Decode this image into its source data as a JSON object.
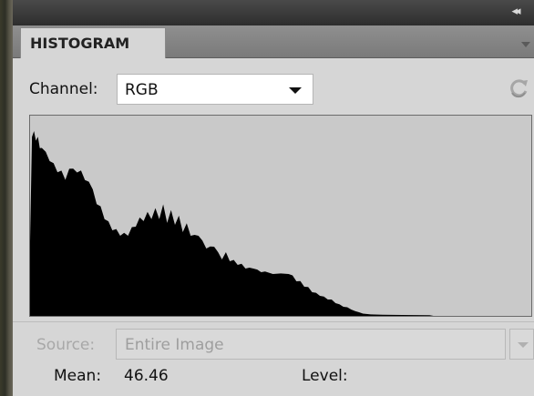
{
  "panel": {
    "tab_title": "HISTOGRAM",
    "collapse_glyph": "◂◂"
  },
  "channel": {
    "label": "Channel:",
    "value": "RGB"
  },
  "source": {
    "label": "Source:",
    "value": "Entire Image"
  },
  "stats": {
    "mean_label": "Mean:",
    "mean_value": "46.46",
    "level_label": "Level:"
  },
  "colors": {
    "panel_bg": "#d6d6d6",
    "histogram_bg": "#c9c9c9",
    "histogram_fill": "#000000"
  },
  "icons": [
    "collapse-panel-icon",
    "panel-menu-icon",
    "dropdown-arrow-icon",
    "refresh-icon"
  ],
  "histogram": {
    "bins": 256,
    "relative_counts": [
      [
        0,
        0.41
      ],
      [
        1,
        0.94
      ],
      [
        2,
        1.0
      ],
      [
        3,
        0.92
      ],
      [
        4,
        0.97
      ],
      [
        5,
        0.88
      ],
      [
        6,
        0.91
      ],
      [
        8,
        0.86
      ],
      [
        10,
        0.84
      ],
      [
        12,
        0.8
      ],
      [
        14,
        0.78
      ],
      [
        16,
        0.76
      ],
      [
        18,
        0.74
      ],
      [
        20,
        0.77
      ],
      [
        22,
        0.8
      ],
      [
        24,
        0.75
      ],
      [
        26,
        0.79
      ],
      [
        28,
        0.71
      ],
      [
        30,
        0.73
      ],
      [
        32,
        0.66
      ],
      [
        34,
        0.61
      ],
      [
        36,
        0.57
      ],
      [
        38,
        0.53
      ],
      [
        40,
        0.49
      ],
      [
        42,
        0.47
      ],
      [
        44,
        0.45
      ],
      [
        46,
        0.44
      ],
      [
        48,
        0.43
      ],
      [
        50,
        0.44
      ],
      [
        52,
        0.46
      ],
      [
        54,
        0.49
      ],
      [
        56,
        0.51
      ],
      [
        58,
        0.52
      ],
      [
        60,
        0.54
      ],
      [
        62,
        0.53
      ],
      [
        64,
        0.56
      ],
      [
        66,
        0.53
      ],
      [
        68,
        0.58
      ],
      [
        70,
        0.51
      ],
      [
        72,
        0.55
      ],
      [
        74,
        0.5
      ],
      [
        76,
        0.52
      ],
      [
        78,
        0.46
      ],
      [
        80,
        0.48
      ],
      [
        82,
        0.44
      ],
      [
        84,
        0.42
      ],
      [
        86,
        0.44
      ],
      [
        88,
        0.39
      ],
      [
        90,
        0.37
      ],
      [
        92,
        0.36
      ],
      [
        94,
        0.38
      ],
      [
        96,
        0.33
      ],
      [
        98,
        0.31
      ],
      [
        100,
        0.33
      ],
      [
        102,
        0.3
      ],
      [
        104,
        0.29
      ],
      [
        106,
        0.28
      ],
      [
        108,
        0.27
      ],
      [
        110,
        0.26
      ],
      [
        112,
        0.25
      ],
      [
        114,
        0.26
      ],
      [
        116,
        0.24
      ],
      [
        118,
        0.24
      ],
      [
        120,
        0.23
      ],
      [
        124,
        0.23
      ],
      [
        128,
        0.22
      ],
      [
        132,
        0.23
      ],
      [
        134,
        0.21
      ],
      [
        136,
        0.19
      ],
      [
        138,
        0.18
      ],
      [
        140,
        0.16
      ],
      [
        142,
        0.15
      ],
      [
        144,
        0.13
      ],
      [
        146,
        0.12
      ],
      [
        148,
        0.11
      ],
      [
        150,
        0.1
      ],
      [
        152,
        0.09
      ],
      [
        154,
        0.085
      ],
      [
        156,
        0.07
      ],
      [
        158,
        0.06
      ],
      [
        160,
        0.05
      ],
      [
        162,
        0.045
      ],
      [
        164,
        0.035
      ],
      [
        166,
        0.025
      ],
      [
        168,
        0.02
      ],
      [
        170,
        0.012
      ],
      [
        174,
        0.008
      ],
      [
        180,
        0.006
      ],
      [
        190,
        0.005
      ],
      [
        204,
        0.004
      ],
      [
        206,
        0.0
      ],
      [
        255,
        0.0
      ]
    ]
  }
}
